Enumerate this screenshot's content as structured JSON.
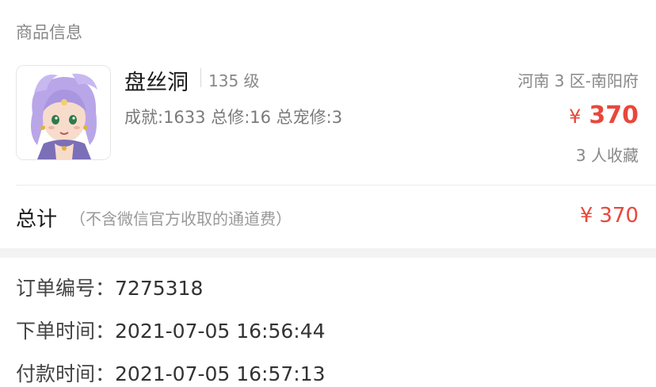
{
  "section": {
    "title": "商品信息"
  },
  "product": {
    "name": "盘丝洞",
    "level": "135 级",
    "stats": "成就:1633 总修:16 总宠修:3",
    "server": "河南 3 区-南阳府",
    "currency": "¥",
    "price": "370",
    "favorites": "3 人收藏",
    "image_icon": "character-portrait"
  },
  "total": {
    "label": "总计",
    "note": "（不含微信官方收取的通道费）",
    "currency": "¥",
    "amount": "370"
  },
  "order": {
    "number_label": "订单编号：",
    "number_value": "7275318",
    "placed_label": "下单时间：",
    "placed_value": "2021-07-05 16:56:44",
    "paid_label": "付款时间：",
    "paid_value": "2021-07-05 16:57:13"
  },
  "colors": {
    "price": "#e8473b",
    "muted": "#888888",
    "band": "#f3f3f3"
  }
}
